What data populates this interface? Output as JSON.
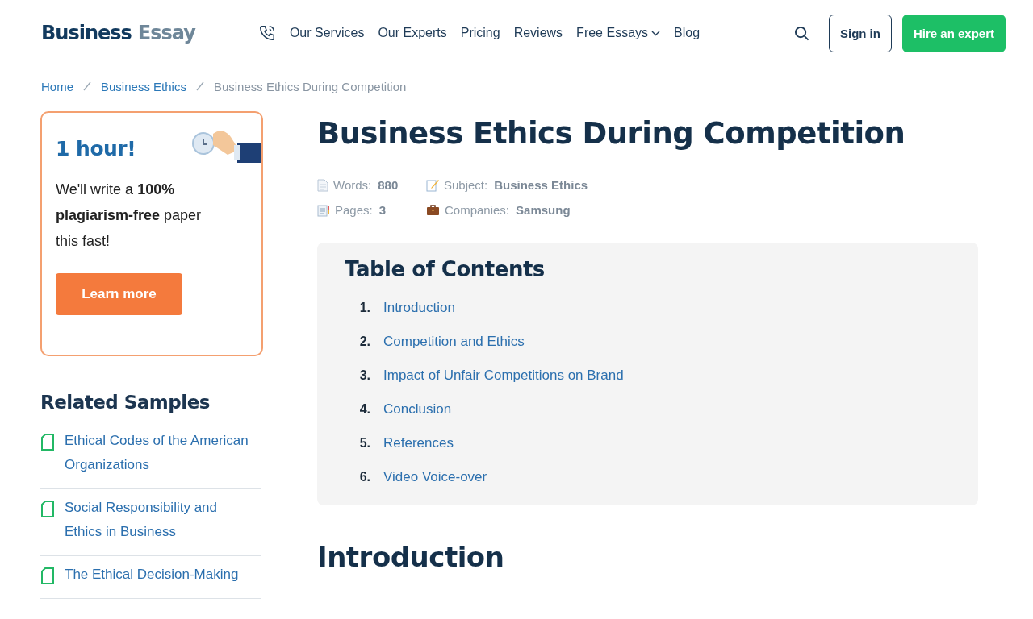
{
  "header": {
    "logo": {
      "word_1": "Business",
      "word_2": "Essay"
    },
    "nav": [
      {
        "label": "Our Services",
        "dropdown": false
      },
      {
        "label": "Our Experts",
        "dropdown": false
      },
      {
        "label": "Pricing",
        "dropdown": false
      },
      {
        "label": "Reviews",
        "dropdown": false
      },
      {
        "label": "Free Essays",
        "dropdown": true
      },
      {
        "label": "Blog",
        "dropdown": false
      }
    ],
    "sign_in": "Sign in",
    "hire": "Hire an expert"
  },
  "breadcrumb": [
    {
      "label": "Home",
      "current": false
    },
    {
      "label": "Business Ethics",
      "current": false
    },
    {
      "label": "Business Ethics During Competition",
      "current": true
    }
  ],
  "promo": {
    "title": "1 hour!",
    "text": "We'll write a **100% plagiarism-free** paper this fast!",
    "button": "Learn more"
  },
  "related": {
    "title": "Related Samples",
    "items": [
      "Ethical Codes of the American Organizations",
      "Social Responsibility and Ethics in Business",
      "The Ethical Decision-Making"
    ]
  },
  "article": {
    "title": "Business Ethics During Competition",
    "meta": [
      {
        "kind": "words",
        "label": "Words:",
        "value": "880"
      },
      {
        "kind": "subject",
        "label": "Subject:",
        "value": "Business Ethics"
      },
      {
        "kind": "pages",
        "label": "Pages:",
        "value": "3"
      },
      {
        "kind": "companies",
        "label": "Companies:",
        "value": "Samsung"
      }
    ],
    "toc": {
      "title": "Table of Contents",
      "items": [
        {
          "number": "1.",
          "label": "Introduction"
        },
        {
          "number": "2.",
          "label": "Competition and Ethics"
        },
        {
          "number": "3.",
          "label": "Impact of Unfair Competitions on Brand"
        },
        {
          "number": "4.",
          "label": "Conclusion"
        },
        {
          "number": "5.",
          "label": "References"
        },
        {
          "number": "6.",
          "label": "Video Voice-over"
        }
      ]
    },
    "section_title": "Introduction"
  }
}
